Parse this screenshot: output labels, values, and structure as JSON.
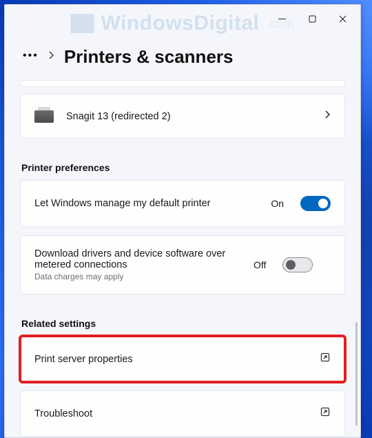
{
  "titlebar": {
    "min": "minimize",
    "max": "maximize",
    "close": "close"
  },
  "header": {
    "ellipsis": "•••",
    "title": "Printers & scanners"
  },
  "printer": {
    "name": "Snagit 13 (redirected 2)"
  },
  "sections": {
    "preferences": "Printer preferences",
    "related": "Related settings"
  },
  "prefs": {
    "default_label": "Let Windows manage my default printer",
    "default_state": "On",
    "metered_label": "Download drivers and device software over metered connections",
    "metered_sub": "Data charges may apply",
    "metered_state": "Off"
  },
  "related": {
    "print_server": "Print server properties",
    "troubleshoot": "Troubleshoot"
  },
  "watermark": {
    "text": "WindowsDigital",
    "suffix": ".com"
  }
}
